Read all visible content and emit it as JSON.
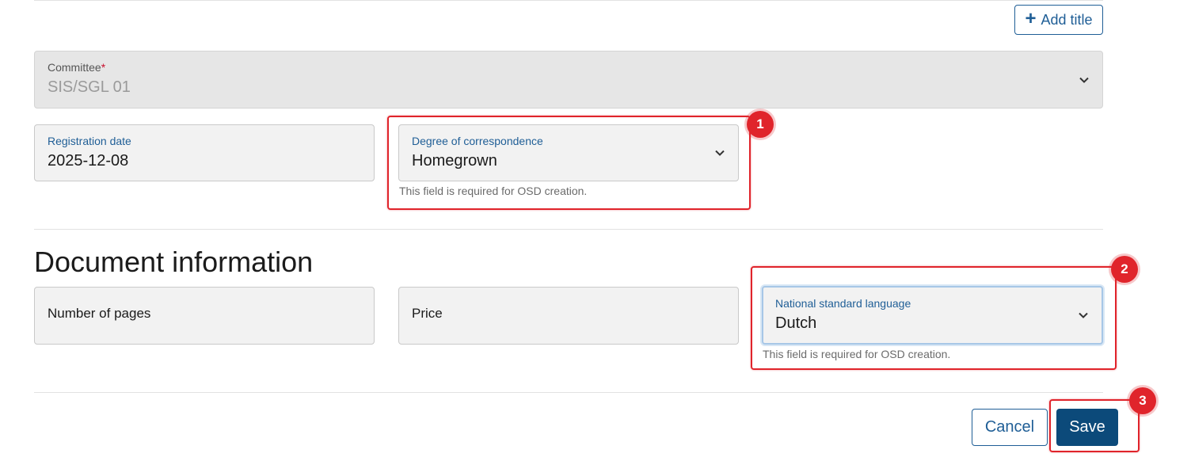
{
  "header": {
    "add_title_label": "Add title"
  },
  "committee": {
    "label": "Committee",
    "required_mark": "*",
    "value": "SIS/SGL 01"
  },
  "registration_date": {
    "label": "Registration date",
    "value": "2025-12-08"
  },
  "degree_of_correspondence": {
    "label": "Degree of correspondence",
    "value": "Homegrown",
    "helper": "This field is required for OSD creation."
  },
  "document_information": {
    "title": "Document information",
    "number_of_pages": {
      "label": "Number of pages"
    },
    "price": {
      "label": "Price"
    },
    "national_standard_language": {
      "label": "National standard language",
      "value": "Dutch",
      "helper": "This field is required for OSD creation."
    }
  },
  "footer": {
    "cancel_label": "Cancel",
    "save_label": "Save"
  },
  "annotations": {
    "badge_1": "1",
    "badge_2": "2",
    "badge_3": "3"
  },
  "colors": {
    "accent": "#1f5e96",
    "primary_button": "#0c4a7a",
    "annotation": "#e0242b"
  }
}
